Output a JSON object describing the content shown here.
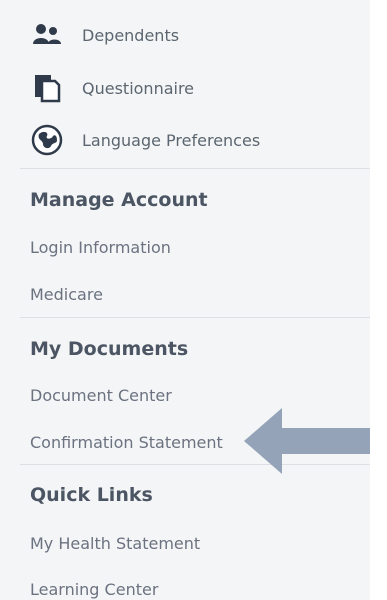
{
  "nav": {
    "top_items": [
      {
        "label": "Dependents",
        "icon": "people-icon"
      },
      {
        "label": "Questionnaire",
        "icon": "documents-icon"
      },
      {
        "label": "Language Preferences",
        "icon": "globe-icon"
      }
    ],
    "sections": [
      {
        "title": "Manage Account",
        "links": [
          "Login Information",
          "Medicare"
        ]
      },
      {
        "title": "My Documents",
        "links": [
          "Document Center",
          "Confirmation Statement"
        ]
      },
      {
        "title": "Quick Links",
        "links": [
          "My Health Statement",
          "Learning Center"
        ]
      }
    ]
  },
  "colors": {
    "panel_bg": "#f4f5f6",
    "icon": "#2f3a4a",
    "arrow": "#94a3b8"
  }
}
